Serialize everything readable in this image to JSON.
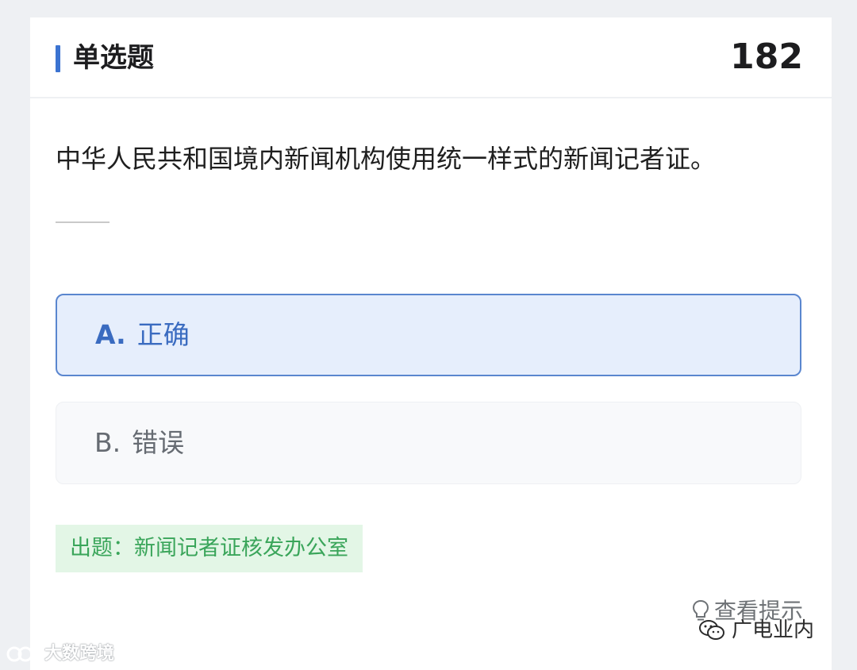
{
  "header": {
    "question_type": "单选题",
    "question_number": "182"
  },
  "question": {
    "text": "中华人民共和国境内新闻机构使用统一样式的新闻记者证。"
  },
  "options": [
    {
      "letter": "A.",
      "text": "正确",
      "selected": true
    },
    {
      "letter": "B.",
      "text": "错误",
      "selected": false
    }
  ],
  "source": {
    "text": "出题：新闻记者证核发办公室"
  },
  "hint": {
    "label": "查看提示",
    "icon": "lightbulb-icon"
  },
  "watermarks": {
    "left": "大数跨境",
    "right": "广电业内"
  },
  "colors": {
    "accent": "#3b73d1",
    "selected_bg": "#e6eefc",
    "selected_border": "#5a86cf",
    "source_bg": "#e3f6e6",
    "source_text": "#3aa55a"
  }
}
